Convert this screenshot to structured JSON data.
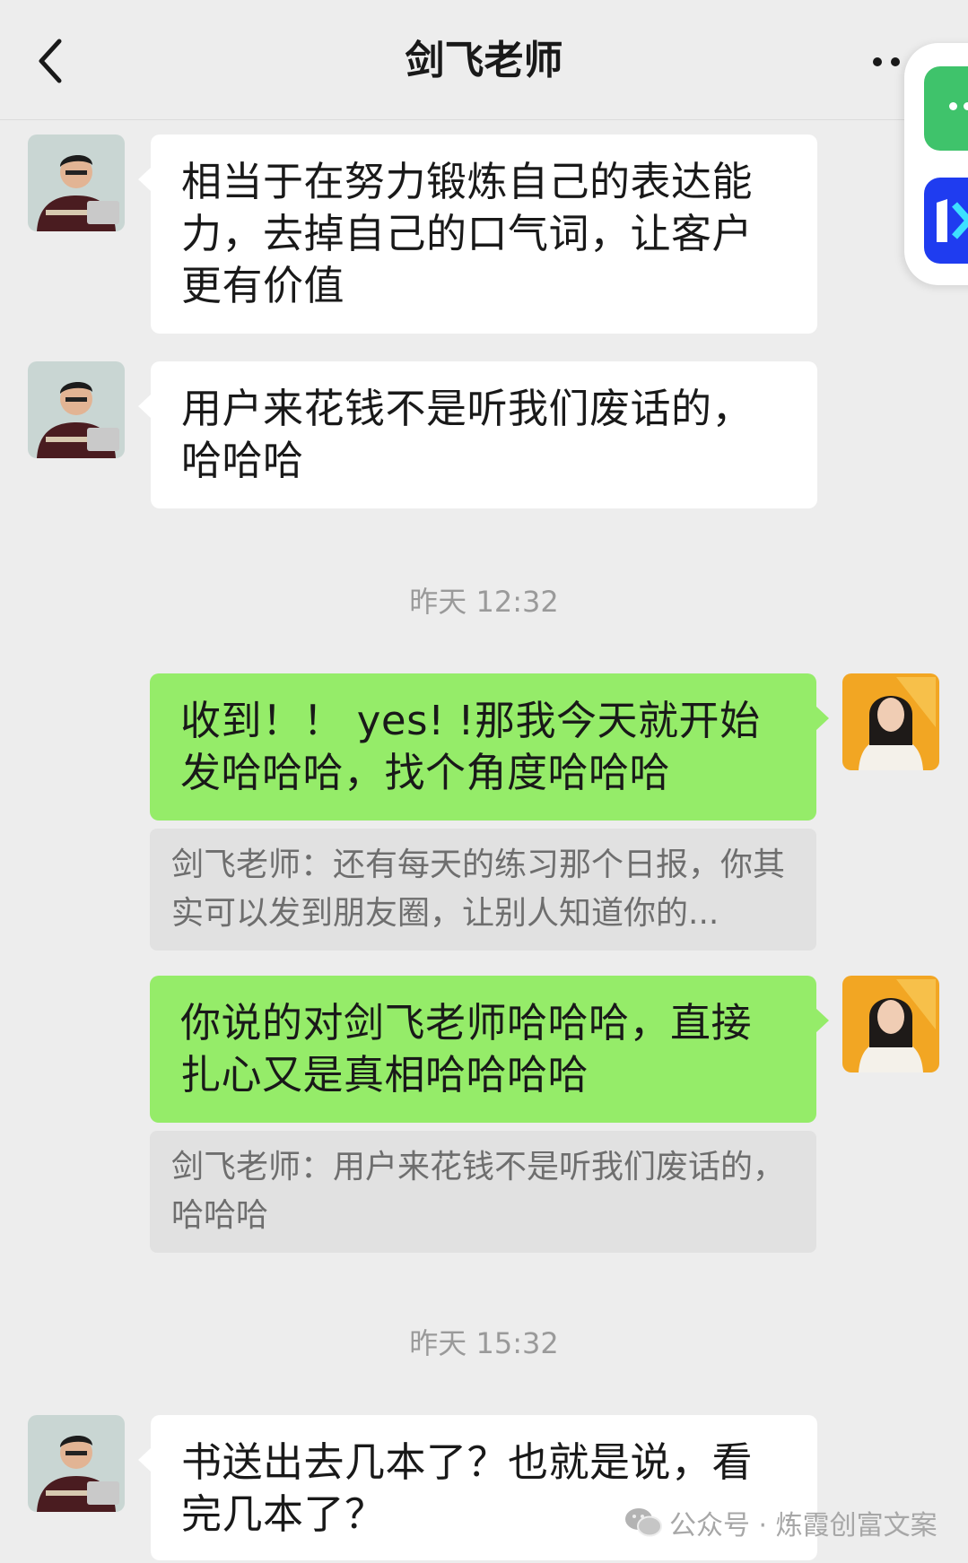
{
  "header": {
    "title": "剑飞老师",
    "back_icon": "chevron-left-icon",
    "more_icon": "more-horizontal-icon"
  },
  "messages": [
    {
      "side": "left",
      "text": "相当于在努力锻炼自己的表达能力，去掉自己的口气词，让客户更有价值"
    },
    {
      "side": "left",
      "text": "用户来花钱不是听我们废话的，哈哈哈"
    },
    {
      "type": "time",
      "text": "昨天 12:32"
    },
    {
      "side": "right",
      "text": "收到！！ yes! !那我今天就开始发哈哈哈，找个角度哈哈哈"
    },
    {
      "type": "quote",
      "text": "剑飞老师：还有每天的练习那个日报，你其实可以发到朋友圈，让别人知道你的..."
    },
    {
      "side": "right",
      "text": "你说的对剑飞老师哈哈哈，直接扎心又是真相哈哈哈哈"
    },
    {
      "type": "quote",
      "text": "剑飞老师：用户来花钱不是听我们废话的，哈哈哈"
    },
    {
      "type": "time",
      "text": "昨天 15:32"
    },
    {
      "side": "left",
      "text": "书送出去几本了？也就是说，看完几本了？"
    }
  ],
  "watermark": {
    "text": "公众号 · 炼霞创富文案",
    "icon": "wechat-icon"
  },
  "colors": {
    "background": "#ededed",
    "bubble_self": "#95ec69",
    "bubble_other": "#ffffff",
    "quote_bg": "#e1e1e1"
  }
}
